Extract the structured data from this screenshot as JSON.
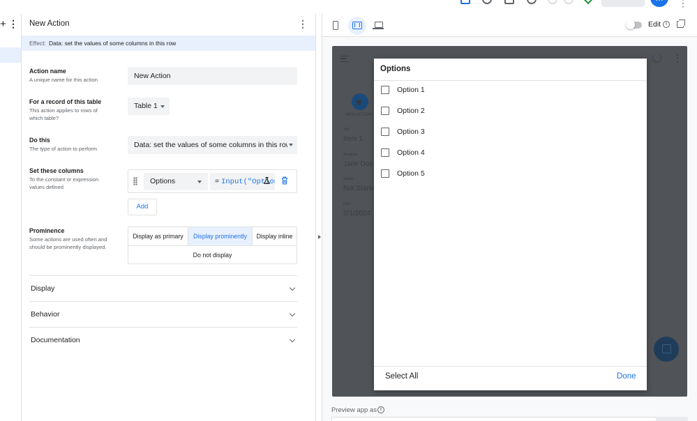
{
  "editor": {
    "title": "New Action",
    "effect": {
      "label": "Effect:",
      "value": "Data: set the values of some columns in this row"
    },
    "action_name": {
      "title": "Action name",
      "desc": "A unique name for this action",
      "value": "New Action"
    },
    "for_record": {
      "title": "For a record of this table",
      "desc": "This action applies to rows of which table?",
      "value": "Table 1"
    },
    "do_this": {
      "title": "Do this",
      "desc": "The type of action to perform",
      "value": "Data: set the values of some columns in this row"
    },
    "set_columns": {
      "title": "Set these columns",
      "desc": "To the constant or expression values defined",
      "column": "Options",
      "expression_prefix": "=",
      "expression_code": "Input(\"Options\"",
      "add_label": "Add"
    },
    "prominence": {
      "title": "Prominence",
      "desc": "Some actions are used often and should be prominently displayed.",
      "options": [
        "Display as primary",
        "Display prominently",
        "Display inline"
      ],
      "selected": "Display prominently",
      "none_option": "Do not display"
    },
    "sections": [
      "Display",
      "Behavior",
      "Documentation"
    ]
  },
  "preview": {
    "edit_label": "Edit",
    "info_glyph": "i",
    "app": {
      "new_action_label": "NEW ACTION",
      "fields": [
        {
          "label": "Title",
          "value": "Item 1"
        },
        {
          "label": "Assignee",
          "value": "Jane Doe"
        },
        {
          "label": "Status",
          "value": "Not Started"
        },
        {
          "label": "Date",
          "value": "2/1/2024"
        }
      ]
    },
    "dialog": {
      "title": "Options",
      "options": [
        "Option 1",
        "Option 2",
        "Option 3",
        "Option 4",
        "Option 5"
      ],
      "select_all": "Select All",
      "done": "Done"
    },
    "preview_as_label": "Preview app as"
  },
  "topbar": {
    "avatar_initial": "M"
  },
  "colors": {
    "accent": "#1a73e8",
    "selected_bg": "#e8f0fe",
    "device_overlay": "#505357"
  },
  "icons": [
    "plus-icon",
    "kebab-icon",
    "drag-handle-icon",
    "flask-icon",
    "trash-icon",
    "chevron-down-icon",
    "phone-icon",
    "tablet-icon",
    "laptop-icon",
    "info-icon",
    "open-external-icon",
    "checkbox-icon"
  ]
}
